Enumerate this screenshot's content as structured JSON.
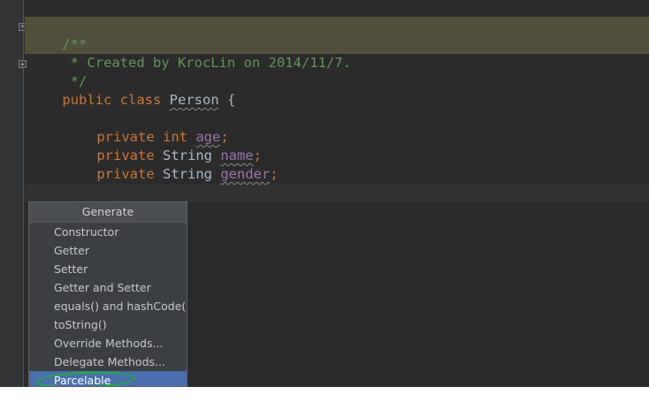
{
  "editor": {
    "lines": {
      "doc_open": "/**",
      "doc_author": " * Created by KrocLin on 2014/11/7.",
      "doc_close": " */",
      "class_modifiers": "public class ",
      "class_name": "Person",
      "class_brace": " {",
      "field_private": "private",
      "type_int": "int",
      "type_string": "String",
      "field_age": "age",
      "field_name": "name",
      "field_gender": "gender",
      "semicolon": ";"
    }
  },
  "generate_popup": {
    "title": "Generate",
    "items": [
      "Constructor",
      "Getter",
      "Setter",
      "Getter and Setter",
      "equals() and hashCode()",
      "toString()",
      "Override Methods...",
      "Delegate Methods...",
      "Parcelable"
    ],
    "selected_index": 8
  },
  "colors": {
    "editor_background": "#2b2b2b",
    "comment": "#629755",
    "keyword": "#cc7832",
    "selection": "#4b6eaf",
    "annotation_circle": "#1eaf3c"
  },
  "icons": {
    "fold_open": "fold-open-icon",
    "fold_close": "fold-close-icon"
  }
}
